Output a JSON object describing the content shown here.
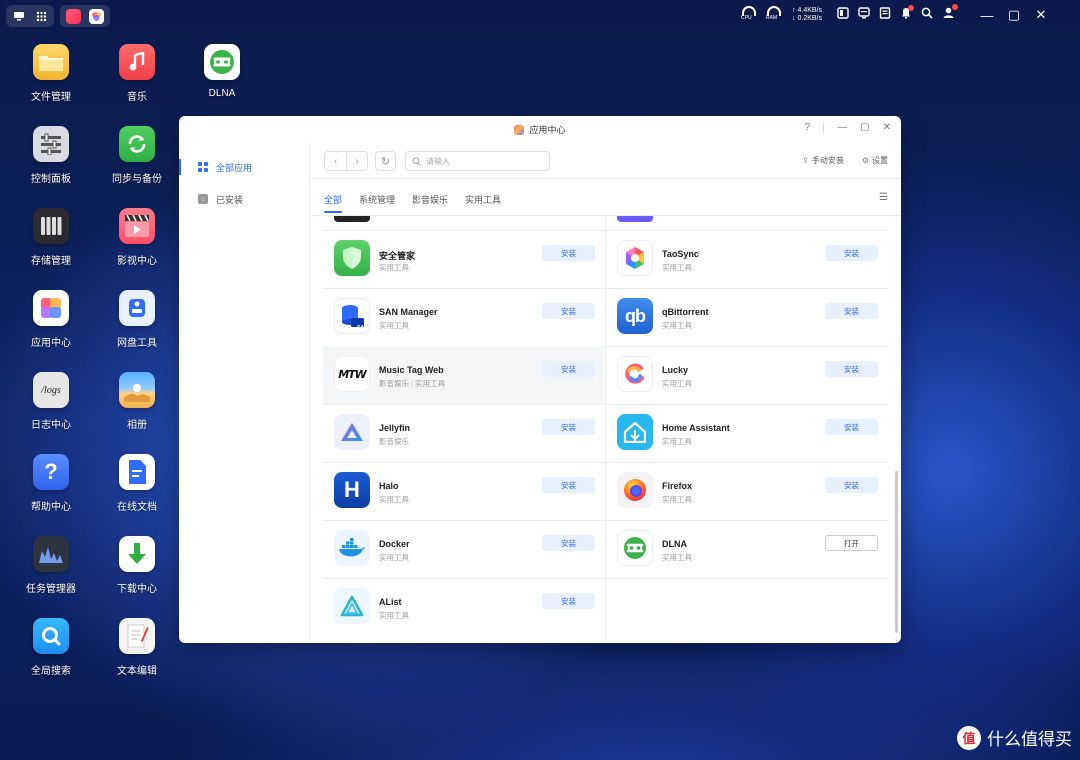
{
  "taskbar": {
    "net_up": "↑ 4.4KB/s",
    "net_down": "↓ 0.2KB/s",
    "cpu_label": "CPU",
    "ram_label": "RAM"
  },
  "desktop": {
    "icons": [
      {
        "label": "文件管理",
        "icon": "folder-icon"
      },
      {
        "label": "音乐",
        "icon": "music-icon"
      },
      {
        "label": "DLNA",
        "icon": "dlna-icon"
      },
      {
        "label": "控制面板",
        "icon": "control-panel-icon"
      },
      {
        "label": "同步与备份",
        "icon": "sync-icon"
      },
      {
        "label": "存储管理",
        "icon": "storage-icon"
      },
      {
        "label": "影视中心",
        "icon": "video-icon"
      },
      {
        "label": "应用中心",
        "icon": "app-center-icon"
      },
      {
        "label": "网盘工具",
        "icon": "cloud-drive-icon"
      },
      {
        "label": "日志中心",
        "icon": "logs-icon"
      },
      {
        "label": "相册",
        "icon": "photos-icon"
      },
      {
        "label": "帮助中心",
        "icon": "help-icon"
      },
      {
        "label": "在线文档",
        "icon": "docs-icon"
      },
      {
        "label": "任务管理器",
        "icon": "task-manager-icon"
      },
      {
        "label": "下载中心",
        "icon": "download-icon"
      },
      {
        "label": "全局搜索",
        "icon": "search-icon"
      },
      {
        "label": "文本编辑",
        "icon": "text-editor-icon"
      }
    ],
    "logs_text": "/logs"
  },
  "window": {
    "title": "应用中心",
    "help": "?",
    "sidebar": [
      {
        "label": "全部应用",
        "active": true
      },
      {
        "label": "已安装",
        "active": false
      }
    ],
    "search_placeholder": "请输入",
    "manual_install": "手动安装",
    "settings": "设置",
    "tabs": [
      {
        "label": "全部",
        "active": true
      },
      {
        "label": "系统管理"
      },
      {
        "label": "影音娱乐"
      },
      {
        "label": "实用工具"
      }
    ],
    "apps_left": [
      {
        "name": "安全管家",
        "category": "实用工具",
        "action": "安装"
      },
      {
        "name": "SAN Manager",
        "category": "实用工具",
        "action": "安装"
      },
      {
        "name": "Music Tag Web",
        "category": "影音娱乐",
        "category2": "实用工具",
        "action": "安装"
      },
      {
        "name": "Jellyfin",
        "category": "影音娱乐",
        "action": "安装"
      },
      {
        "name": "Halo",
        "category": "实用工具",
        "action": "安装"
      },
      {
        "name": "Docker",
        "category": "实用工具",
        "action": "安装"
      },
      {
        "name": "AList",
        "category": "实用工具",
        "action": "安装"
      }
    ],
    "apps_right": [
      {
        "name": "TaoSync",
        "category": "实用工具",
        "action": "安装"
      },
      {
        "name": "qBittorrent",
        "category": "实用工具",
        "action": "安装"
      },
      {
        "name": "Lucky",
        "category": "实用工具",
        "action": "安装"
      },
      {
        "name": "Home Assistant",
        "category": "实用工具",
        "action": "安装"
      },
      {
        "name": "Firefox",
        "category": "实用工具",
        "action": "安装"
      },
      {
        "name": "DLNA",
        "category": "实用工具",
        "action": "打开"
      }
    ],
    "icon_text": {
      "san": "SAN",
      "qb": "qb",
      "halo": "H",
      "mtw": "MTW"
    }
  },
  "watermark": {
    "badge": "值",
    "text": "什么值得买"
  }
}
